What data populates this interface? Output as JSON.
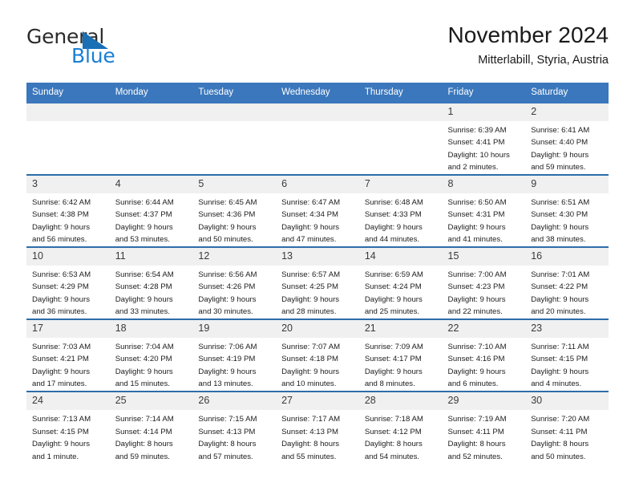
{
  "brand": {
    "name_top": "General",
    "name_bottom": "Blue",
    "triangle_icon": "blue-triangle-icon",
    "blue": "#1a7fd4"
  },
  "header": {
    "title": "November 2024",
    "subtitle": "Mitterlabill, Styria, Austria",
    "accent_color": "#3b77bc",
    "band_color": "#f0f0f0"
  },
  "weekdays": [
    "Sunday",
    "Monday",
    "Tuesday",
    "Wednesday",
    "Thursday",
    "Friday",
    "Saturday"
  ],
  "weeks": [
    [
      {
        "day": "",
        "lines": []
      },
      {
        "day": "",
        "lines": []
      },
      {
        "day": "",
        "lines": []
      },
      {
        "day": "",
        "lines": []
      },
      {
        "day": "",
        "lines": []
      },
      {
        "day": "1",
        "lines": [
          "Sunrise: 6:39 AM",
          "Sunset: 4:41 PM",
          "Daylight: 10 hours",
          "and 2 minutes."
        ]
      },
      {
        "day": "2",
        "lines": [
          "Sunrise: 6:41 AM",
          "Sunset: 4:40 PM",
          "Daylight: 9 hours",
          "and 59 minutes."
        ]
      }
    ],
    [
      {
        "day": "3",
        "lines": [
          "Sunrise: 6:42 AM",
          "Sunset: 4:38 PM",
          "Daylight: 9 hours",
          "and 56 minutes."
        ]
      },
      {
        "day": "4",
        "lines": [
          "Sunrise: 6:44 AM",
          "Sunset: 4:37 PM",
          "Daylight: 9 hours",
          "and 53 minutes."
        ]
      },
      {
        "day": "5",
        "lines": [
          "Sunrise: 6:45 AM",
          "Sunset: 4:36 PM",
          "Daylight: 9 hours",
          "and 50 minutes."
        ]
      },
      {
        "day": "6",
        "lines": [
          "Sunrise: 6:47 AM",
          "Sunset: 4:34 PM",
          "Daylight: 9 hours",
          "and 47 minutes."
        ]
      },
      {
        "day": "7",
        "lines": [
          "Sunrise: 6:48 AM",
          "Sunset: 4:33 PM",
          "Daylight: 9 hours",
          "and 44 minutes."
        ]
      },
      {
        "day": "8",
        "lines": [
          "Sunrise: 6:50 AM",
          "Sunset: 4:31 PM",
          "Daylight: 9 hours",
          "and 41 minutes."
        ]
      },
      {
        "day": "9",
        "lines": [
          "Sunrise: 6:51 AM",
          "Sunset: 4:30 PM",
          "Daylight: 9 hours",
          "and 38 minutes."
        ]
      }
    ],
    [
      {
        "day": "10",
        "lines": [
          "Sunrise: 6:53 AM",
          "Sunset: 4:29 PM",
          "Daylight: 9 hours",
          "and 36 minutes."
        ]
      },
      {
        "day": "11",
        "lines": [
          "Sunrise: 6:54 AM",
          "Sunset: 4:28 PM",
          "Daylight: 9 hours",
          "and 33 minutes."
        ]
      },
      {
        "day": "12",
        "lines": [
          "Sunrise: 6:56 AM",
          "Sunset: 4:26 PM",
          "Daylight: 9 hours",
          "and 30 minutes."
        ]
      },
      {
        "day": "13",
        "lines": [
          "Sunrise: 6:57 AM",
          "Sunset: 4:25 PM",
          "Daylight: 9 hours",
          "and 28 minutes."
        ]
      },
      {
        "day": "14",
        "lines": [
          "Sunrise: 6:59 AM",
          "Sunset: 4:24 PM",
          "Daylight: 9 hours",
          "and 25 minutes."
        ]
      },
      {
        "day": "15",
        "lines": [
          "Sunrise: 7:00 AM",
          "Sunset: 4:23 PM",
          "Daylight: 9 hours",
          "and 22 minutes."
        ]
      },
      {
        "day": "16",
        "lines": [
          "Sunrise: 7:01 AM",
          "Sunset: 4:22 PM",
          "Daylight: 9 hours",
          "and 20 minutes."
        ]
      }
    ],
    [
      {
        "day": "17",
        "lines": [
          "Sunrise: 7:03 AM",
          "Sunset: 4:21 PM",
          "Daylight: 9 hours",
          "and 17 minutes."
        ]
      },
      {
        "day": "18",
        "lines": [
          "Sunrise: 7:04 AM",
          "Sunset: 4:20 PM",
          "Daylight: 9 hours",
          "and 15 minutes."
        ]
      },
      {
        "day": "19",
        "lines": [
          "Sunrise: 7:06 AM",
          "Sunset: 4:19 PM",
          "Daylight: 9 hours",
          "and 13 minutes."
        ]
      },
      {
        "day": "20",
        "lines": [
          "Sunrise: 7:07 AM",
          "Sunset: 4:18 PM",
          "Daylight: 9 hours",
          "and 10 minutes."
        ]
      },
      {
        "day": "21",
        "lines": [
          "Sunrise: 7:09 AM",
          "Sunset: 4:17 PM",
          "Daylight: 9 hours",
          "and 8 minutes."
        ]
      },
      {
        "day": "22",
        "lines": [
          "Sunrise: 7:10 AM",
          "Sunset: 4:16 PM",
          "Daylight: 9 hours",
          "and 6 minutes."
        ]
      },
      {
        "day": "23",
        "lines": [
          "Sunrise: 7:11 AM",
          "Sunset: 4:15 PM",
          "Daylight: 9 hours",
          "and 4 minutes."
        ]
      }
    ],
    [
      {
        "day": "24",
        "lines": [
          "Sunrise: 7:13 AM",
          "Sunset: 4:15 PM",
          "Daylight: 9 hours",
          "and 1 minute."
        ]
      },
      {
        "day": "25",
        "lines": [
          "Sunrise: 7:14 AM",
          "Sunset: 4:14 PM",
          "Daylight: 8 hours",
          "and 59 minutes."
        ]
      },
      {
        "day": "26",
        "lines": [
          "Sunrise: 7:15 AM",
          "Sunset: 4:13 PM",
          "Daylight: 8 hours",
          "and 57 minutes."
        ]
      },
      {
        "day": "27",
        "lines": [
          "Sunrise: 7:17 AM",
          "Sunset: 4:13 PM",
          "Daylight: 8 hours",
          "and 55 minutes."
        ]
      },
      {
        "day": "28",
        "lines": [
          "Sunrise: 7:18 AM",
          "Sunset: 4:12 PM",
          "Daylight: 8 hours",
          "and 54 minutes."
        ]
      },
      {
        "day": "29",
        "lines": [
          "Sunrise: 7:19 AM",
          "Sunset: 4:11 PM",
          "Daylight: 8 hours",
          "and 52 minutes."
        ]
      },
      {
        "day": "30",
        "lines": [
          "Sunrise: 7:20 AM",
          "Sunset: 4:11 PM",
          "Daylight: 8 hours",
          "and 50 minutes."
        ]
      }
    ]
  ]
}
